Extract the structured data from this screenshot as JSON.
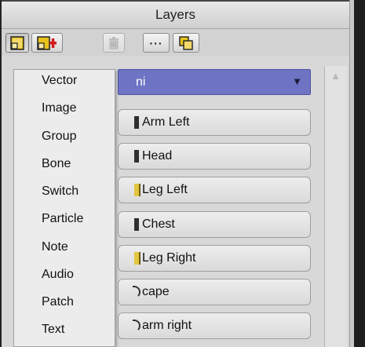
{
  "panel": {
    "title": "Layers"
  },
  "toolbar": {
    "buttons": [
      {
        "name": "new-layer-button",
        "icon": "new-layer-icon"
      },
      {
        "name": "add-layer-button",
        "icon": "add-layer-icon"
      },
      {
        "name": "delete-layer-button",
        "icon": "trash-icon"
      },
      {
        "name": "more-options-button",
        "label": "···",
        "icon": "ellipsis-icon"
      },
      {
        "name": "duplicate-layer-button",
        "icon": "duplicate-icon"
      }
    ]
  },
  "selected_layer": {
    "label": "ni",
    "dropdown_icon": "triangle-down-icon"
  },
  "layers": [
    {
      "label": "Arm Left",
      "icon": "bone-icon"
    },
    {
      "label": "Head",
      "icon": "bone-icon"
    },
    {
      "label": "Leg Left",
      "icon": "yellow-layer-icon"
    },
    {
      "label": "Chest",
      "icon": "bone-icon"
    },
    {
      "label": "Leg Right",
      "icon": "yellow-layer-icon"
    },
    {
      "label": "cape",
      "icon": "curve-icon"
    },
    {
      "label": "arm right",
      "icon": "curve-icon"
    }
  ],
  "menu": {
    "items": [
      "Vector",
      "Image",
      "Group",
      "Bone",
      "Switch",
      "Particle",
      "Note",
      "Audio",
      "Patch",
      "Text"
    ]
  },
  "colors": {
    "selected_row": "#6e73c4",
    "selected_text": "#ffffff",
    "add_icon_red": "#d11c1c",
    "new_layer_yellow": "#e8c21c"
  }
}
